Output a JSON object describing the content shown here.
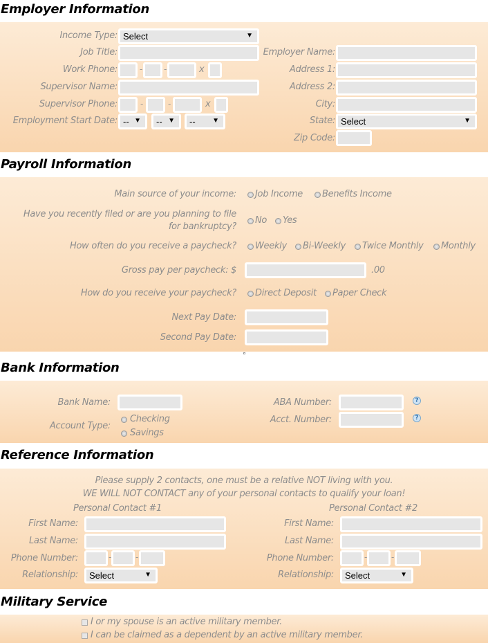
{
  "employer": {
    "title": "Employer Information",
    "income_type": "Income Type:",
    "income_select": "Select",
    "job_title": "Job Title:",
    "work_phone": "Work Phone:",
    "supervisor_name": "Supervisor Name:",
    "supervisor_phone": "Supervisor Phone:",
    "start_date": "Employment Start Date:",
    "date_placeholder": "--",
    "employer_name": "Employer Name:",
    "address1": "Address 1:",
    "address2": "Address 2:",
    "city": "City:",
    "state": "State:",
    "state_select": "Select",
    "zip": "Zip Code:",
    "ext": "x",
    "dash": "-"
  },
  "payroll": {
    "title": "Payroll Information",
    "main_source": "Main source of your income:",
    "job_income": "Job Income",
    "benefits_income": "Benefits Income",
    "bankruptcy_1": "Have you recently filed or are you planning to file",
    "bankruptcy_2": "for bankruptcy?",
    "no": "No",
    "yes": "Yes",
    "how_often": "How often do you receive a paycheck?",
    "weekly": "Weekly",
    "biweekly": "Bi-Weekly",
    "twice_monthly": "Twice Monthly",
    "monthly": "Monthly",
    "gross_pay": "Gross pay per paycheck: $",
    "cents": ".00",
    "how_receive": "How do you receive your paycheck?",
    "direct_deposit": "Direct Deposit",
    "paper_check": "Paper Check",
    "next_pay": "Next Pay Date:",
    "second_pay": "Second Pay Date:"
  },
  "bank": {
    "title": "Bank Information",
    "bank_name": "Bank Name:",
    "aba": "ABA Number:",
    "account_type": "Account Type:",
    "checking": "Checking",
    "savings": "Savings",
    "acct_number": "Acct. Number:",
    "help": "?"
  },
  "reference": {
    "title": "Reference Information",
    "note1": "Please supply 2 contacts, one must be a relative NOT living with you.",
    "note2": "WE WILL NOT CONTACT any of your personal contacts to qualify your loan!",
    "contact1": "Personal Contact #1",
    "contact2": "Personal Contact #2",
    "first_name": "First Name:",
    "last_name": "Last Name:",
    "phone": "Phone Number:",
    "relationship": "Relationship:",
    "select": "Select"
  },
  "military": {
    "title": "Military Service",
    "active": "I or my spouse is an active military member.",
    "dependent": "I can be claimed as a dependent by an active military member."
  },
  "colors": {
    "panel_top": "#fdebd6",
    "panel_bottom": "#f9d5ae",
    "label": "#8d8d8d",
    "input": "#e6e6e6"
  }
}
